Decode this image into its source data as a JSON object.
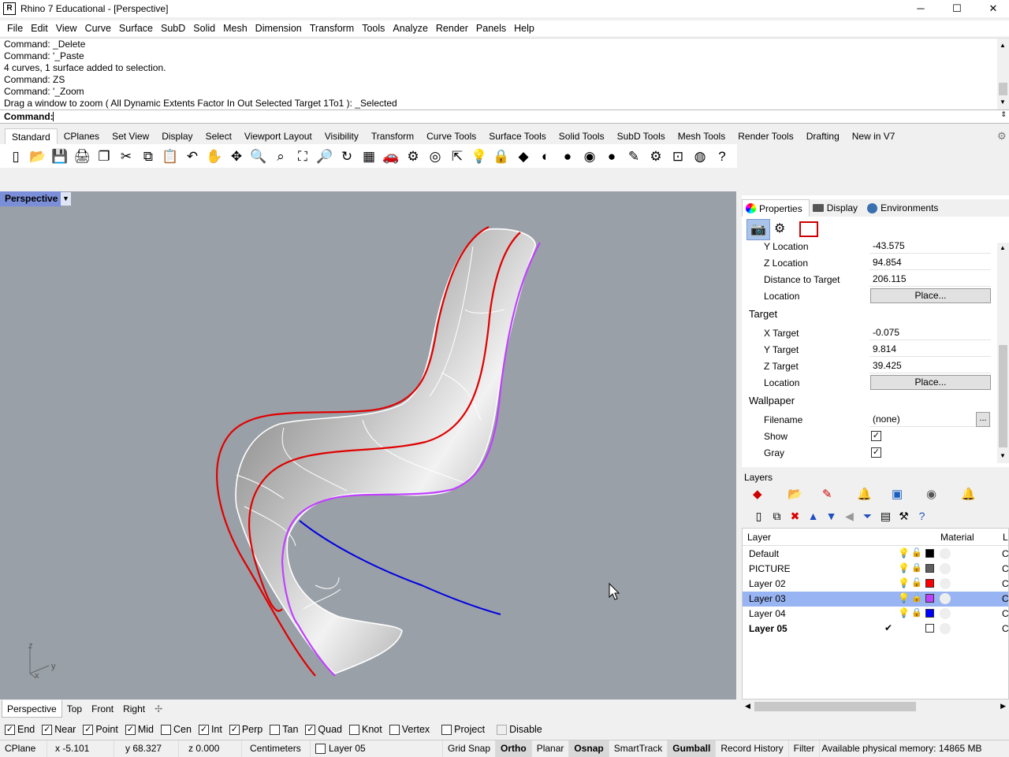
{
  "window": {
    "title": "Rhino 7 Educational - [Perspective]",
    "minimize": "─",
    "maximize": "☐",
    "close": "✕"
  },
  "menu": [
    "File",
    "Edit",
    "View",
    "Curve",
    "Surface",
    "SubD",
    "Solid",
    "Mesh",
    "Dimension",
    "Transform",
    "Tools",
    "Analyze",
    "Render",
    "Panels",
    "Help"
  ],
  "history": [
    "Command: _Delete",
    "Command: '_Paste",
    "4 curves, 1 surface added to selection.",
    "Command: ZS",
    "Command: '_Zoom",
    "Drag a window to zoom ( All  Dynamic  Extents  Factor  In  Out  Selected  Target  1To1 ): _Selected"
  ],
  "command_prompt": "Command:",
  "toolbar_tabs": [
    "Standard",
    "CPlanes",
    "Set View",
    "Display",
    "Select",
    "Viewport Layout",
    "Visibility",
    "Transform",
    "Curve Tools",
    "Surface Tools",
    "Solid Tools",
    "SubD Tools",
    "Mesh Tools",
    "Render Tools",
    "Drafting",
    "New in V7"
  ],
  "toolbar_icons": [
    "▯",
    "📂",
    "💾",
    "🖨",
    "❐",
    "✂",
    "⧉",
    "📋",
    "↶",
    "✋",
    "✥",
    "🔍",
    "⌕",
    "⛶",
    "🔎",
    "↻",
    "▦",
    "🚗",
    "⚙",
    "◎",
    "⇱",
    "💡",
    "🔒",
    "◆",
    "◐",
    "●",
    "◉",
    "●",
    "✎",
    "⚙",
    "⊡",
    "◍",
    "?"
  ],
  "viewport": {
    "name": "Perspective",
    "axis_z": "z",
    "axis_y": "y",
    "axis_x": "x"
  },
  "viewport_tabs": [
    "Perspective",
    "Top",
    "Front",
    "Right"
  ],
  "viewport_add": "✢",
  "properties": {
    "tabs": [
      "Properties",
      "Display",
      "Environments"
    ],
    "rows_location": [
      {
        "label": "Y Location",
        "value": "-43.575"
      },
      {
        "label": "Z Location",
        "value": "94.854"
      },
      {
        "label": "Distance to Target",
        "value": "206.115"
      }
    ],
    "location_label": "Location",
    "place_button": "Place...",
    "target_section": "Target",
    "target_rows": [
      {
        "label": "X Target",
        "value": "-0.075"
      },
      {
        "label": "Y Target",
        "value": "9.814"
      },
      {
        "label": "Z Target",
        "value": "39.425"
      }
    ],
    "wallpaper_section": "Wallpaper",
    "filename_label": "Filename",
    "filename_value": "(none)",
    "browse_button": "...",
    "show_label": "Show",
    "gray_label": "Gray",
    "check": "✓"
  },
  "layers": {
    "title": "Layers",
    "col_layer": "Layer",
    "col_material": "Material",
    "col_extra": "L",
    "rows": [
      {
        "name": "Default",
        "color": "#000000",
        "bulb": "💡",
        "lock": "🔓"
      },
      {
        "name": "PICTURE",
        "color": "#606060",
        "bulb": "💡",
        "lock": "🔒"
      },
      {
        "name": "Layer 02",
        "color": "#ff0000",
        "bulb": "💡",
        "lock": "🔓"
      },
      {
        "name": "Layer 03",
        "color": "#c040ff",
        "bulb": "💡",
        "lock": "🔓"
      },
      {
        "name": "Layer 04",
        "color": "#0000ff",
        "bulb": "💡",
        "lock": "🔒"
      },
      {
        "name": "Layer 05",
        "color": "#ffffff",
        "bulb": "✔",
        "lock": ""
      }
    ],
    "extra_col": "C"
  },
  "osnaps": [
    {
      "label": "End",
      "checked": true
    },
    {
      "label": "Near",
      "checked": true
    },
    {
      "label": "Point",
      "checked": true
    },
    {
      "label": "Mid",
      "checked": true
    },
    {
      "label": "Cen",
      "checked": false
    },
    {
      "label": "Int",
      "checked": true
    },
    {
      "label": "Perp",
      "checked": true
    },
    {
      "label": "Tan",
      "checked": false
    },
    {
      "label": "Quad",
      "checked": true
    },
    {
      "label": "Knot",
      "checked": false
    },
    {
      "label": "Vertex",
      "checked": false
    },
    {
      "label": "Project",
      "checked": false
    },
    {
      "label": "Disable",
      "checked": false
    }
  ],
  "status": {
    "cplane": "CPlane",
    "x": "x -5.101",
    "y": "y 68.327",
    "z": "z 0.000",
    "units": "Centimeters",
    "layer": "Layer 05",
    "grid_snap": "Grid Snap",
    "ortho": "Ortho",
    "planar": "Planar",
    "osnap": "Osnap",
    "smarttrack": "SmartTrack",
    "gumball": "Gumball",
    "record_history": "Record History",
    "filter": "Filter",
    "memory": "Available physical memory: 14865 MB"
  }
}
